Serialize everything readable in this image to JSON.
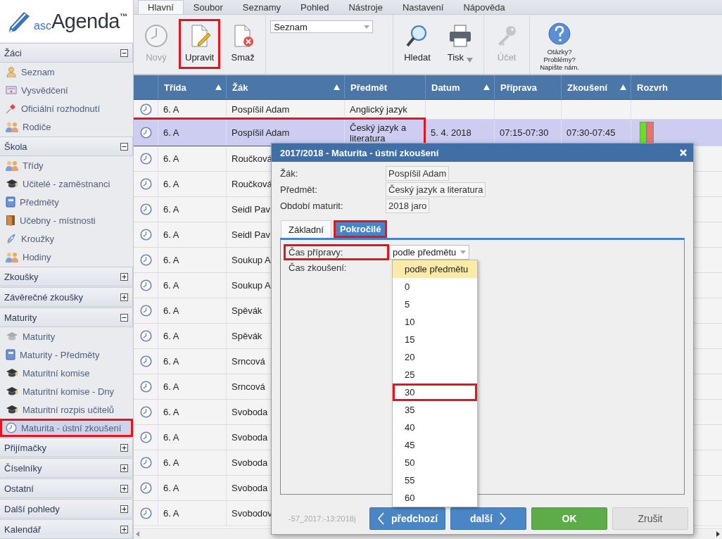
{
  "logo": {
    "prefix": "asc",
    "name": "Agenda",
    "mark": "™"
  },
  "sidebar": {
    "sections": [
      {
        "title": "Žáci",
        "expanded": true,
        "items": [
          {
            "label": "Seznam",
            "selected": false,
            "highlighted": false
          },
          {
            "label": "Vysvědčení",
            "selected": false,
            "highlighted": false
          },
          {
            "label": "Oficiální rozhodnutí",
            "selected": false,
            "highlighted": false
          },
          {
            "label": "Rodiče",
            "selected": false,
            "highlighted": false
          }
        ]
      },
      {
        "title": "Škola",
        "expanded": true,
        "items": [
          {
            "label": "Třídy",
            "selected": false,
            "highlighted": false
          },
          {
            "label": "Učitelé - zaměstnanci",
            "selected": false,
            "highlighted": false
          },
          {
            "label": "Předměty",
            "selected": false,
            "highlighted": false
          },
          {
            "label": "Učebny - místnosti",
            "selected": false,
            "highlighted": false
          },
          {
            "label": "Kroužky",
            "selected": false,
            "highlighted": false
          },
          {
            "label": "Hodiny",
            "selected": false,
            "highlighted": false
          }
        ]
      },
      {
        "title": "Zkoušky",
        "expanded": false
      },
      {
        "title": "Závěrečné zkoušky",
        "expanded": false
      },
      {
        "title": "Maturity",
        "expanded": true,
        "items": [
          {
            "label": "Maturity",
            "selected": false,
            "highlighted": false
          },
          {
            "label": "Maturity - Předměty",
            "selected": false,
            "highlighted": false
          },
          {
            "label": "Maturitní komise",
            "selected": false,
            "highlighted": false
          },
          {
            "label": "Maturitní komise - Dny",
            "selected": false,
            "highlighted": false
          },
          {
            "label": "Maturitní rozpis učitelů",
            "selected": false,
            "highlighted": false
          },
          {
            "label": "Maturita - ústní zkoušení",
            "selected": true,
            "highlighted": true
          }
        ]
      },
      {
        "title": "Přijímačky",
        "expanded": false
      },
      {
        "title": "Číselníky",
        "expanded": false
      },
      {
        "title": "Ostatní",
        "expanded": false
      },
      {
        "title": "Další pohledy",
        "expanded": false
      },
      {
        "title": "Kalendář",
        "expanded": false
      }
    ]
  },
  "menu_tabs": [
    {
      "label": "Hlavní",
      "selected": true
    },
    {
      "label": "Soubor",
      "selected": false
    },
    {
      "label": "Seznamy",
      "selected": false
    },
    {
      "label": "Pohled",
      "selected": false
    },
    {
      "label": "Nástroje",
      "selected": false
    },
    {
      "label": "Nastavení",
      "selected": false
    },
    {
      "label": "Nápověda",
      "selected": false
    }
  ],
  "toolbar": {
    "groups": [
      [
        {
          "kind": "button",
          "label": "Nový",
          "disabled": true,
          "highlighted": false
        },
        {
          "kind": "button",
          "label": "Upravit",
          "disabled": false,
          "highlighted": true
        },
        {
          "kind": "button",
          "label": "Smaž",
          "disabled": false,
          "highlighted": false
        }
      ],
      [
        {
          "kind": "select",
          "value": "Seznam"
        }
      ],
      [
        {
          "kind": "button",
          "label": "Hledat",
          "disabled": false,
          "highlighted": false
        },
        {
          "kind": "menu-button",
          "label": "Tisk",
          "disabled": false,
          "highlighted": false
        }
      ],
      [
        {
          "kind": "button",
          "label": "Účet",
          "disabled": true,
          "highlighted": false
        }
      ],
      [
        {
          "kind": "help",
          "lines": [
            "Otázky?",
            "Problémy?",
            "Napište nám."
          ]
        }
      ]
    ]
  },
  "table": {
    "columns": [
      {
        "label": "Třída",
        "sortable": true
      },
      {
        "label": "Žák",
        "sortable": true
      },
      {
        "label": "Předmět",
        "sortable": false
      },
      {
        "label": "Datum",
        "sortable": true
      },
      {
        "label": "Příprava",
        "sortable": false
      },
      {
        "label": "Zkoušení",
        "sortable": true
      },
      {
        "label": "Rozvrh",
        "sortable": false
      }
    ],
    "rows": [
      {
        "class": "6. A",
        "student": "Pospíšil Adam",
        "subject": "Anglický jazyk",
        "selected": false,
        "highlighted": false
      },
      {
        "class": "6. A",
        "student": "Pospíšil Adam",
        "subject": "Český jazyk a literatura",
        "date": "5. 4. 2018",
        "preparation": "07:15-07:30",
        "exam": "07:30-07:45",
        "schedule": [
          {
            "color": "#66e01e"
          },
          {
            "color": "#e8716d"
          }
        ],
        "selected": true,
        "highlighted": true
      },
      {
        "class": "6. A",
        "student": "Roučková",
        "selected": false,
        "highlighted": false
      },
      {
        "class": "6. A",
        "student": "Roučková",
        "selected": false,
        "highlighted": false
      },
      {
        "class": "6. A",
        "student": "Seidl Pav",
        "selected": false,
        "highlighted": false
      },
      {
        "class": "6. A",
        "student": "Seidl Pav",
        "selected": false,
        "highlighted": false
      },
      {
        "class": "6. A",
        "student": "Soukup A",
        "selected": false,
        "highlighted": false
      },
      {
        "class": "6. A",
        "student": "Soukup A",
        "selected": false,
        "highlighted": false
      },
      {
        "class": "6. A",
        "student": "Spěvák",
        "selected": false,
        "highlighted": false
      },
      {
        "class": "6. A",
        "student": "Spěvák",
        "selected": false,
        "highlighted": false
      },
      {
        "class": "6. A",
        "student": "Srncová",
        "selected": false,
        "highlighted": false
      },
      {
        "class": "6. A",
        "student": "Srncová",
        "selected": false,
        "highlighted": false
      },
      {
        "class": "6. A",
        "student": "Svoboda",
        "selected": false,
        "highlighted": false
      },
      {
        "class": "6. A",
        "student": "Svoboda",
        "selected": false,
        "highlighted": false
      },
      {
        "class": "6. A",
        "student": "Svoboda",
        "selected": false,
        "highlighted": false
      },
      {
        "class": "6. A",
        "student": "Svoboda",
        "selected": false,
        "highlighted": false
      },
      {
        "class": "6. A",
        "student": "Svobodov",
        "selected": false,
        "highlighted": false
      }
    ]
  },
  "dialog": {
    "title": "2017/2018 - Maturita - ústní zkoušení",
    "fields": [
      {
        "label": "Žák:",
        "value": "Pospíšil Adam"
      },
      {
        "label": "Předmět:",
        "value": "Český jazyk a literatura"
      },
      {
        "label": "Období maturit:",
        "value": "2018 jaro"
      }
    ],
    "tabs": [
      {
        "label": "Základní",
        "selected": false,
        "highlighted": false
      },
      {
        "label": "Pokročilé",
        "selected": true,
        "highlighted": true
      }
    ],
    "form": [
      {
        "label": "Čas přípravy:",
        "value": "podle předmětu",
        "highlighted": true
      },
      {
        "label": "Čas zkoušení:",
        "highlighted": false
      }
    ],
    "dropdown": [
      {
        "label": "podle předmětu",
        "selected": true,
        "highlighted": false
      },
      {
        "label": "0",
        "selected": false,
        "highlighted": false
      },
      {
        "label": "5",
        "selected": false,
        "highlighted": false
      },
      {
        "label": "10",
        "selected": false,
        "highlighted": false
      },
      {
        "label": "15",
        "selected": false,
        "highlighted": false
      },
      {
        "label": "20",
        "selected": false,
        "highlighted": false
      },
      {
        "label": "25",
        "selected": false,
        "highlighted": false
      },
      {
        "label": "30",
        "selected": false,
        "highlighted": true
      },
      {
        "label": "35",
        "selected": false,
        "highlighted": false
      },
      {
        "label": "40",
        "selected": false,
        "highlighted": false
      },
      {
        "label": "45",
        "selected": false,
        "highlighted": false
      },
      {
        "label": "50",
        "selected": false,
        "highlighted": false
      },
      {
        "label": "55",
        "selected": false,
        "highlighted": false
      },
      {
        "label": "60",
        "selected": false,
        "highlighted": false
      }
    ],
    "record_code": "-57_2017:-13:2018j",
    "buttons": [
      {
        "kind": "previous",
        "label": "předchozí"
      },
      {
        "kind": "next",
        "label": "další"
      },
      {
        "kind": "ok",
        "label": "OK"
      },
      {
        "kind": "cancel",
        "label": "Zrušit"
      }
    ]
  }
}
